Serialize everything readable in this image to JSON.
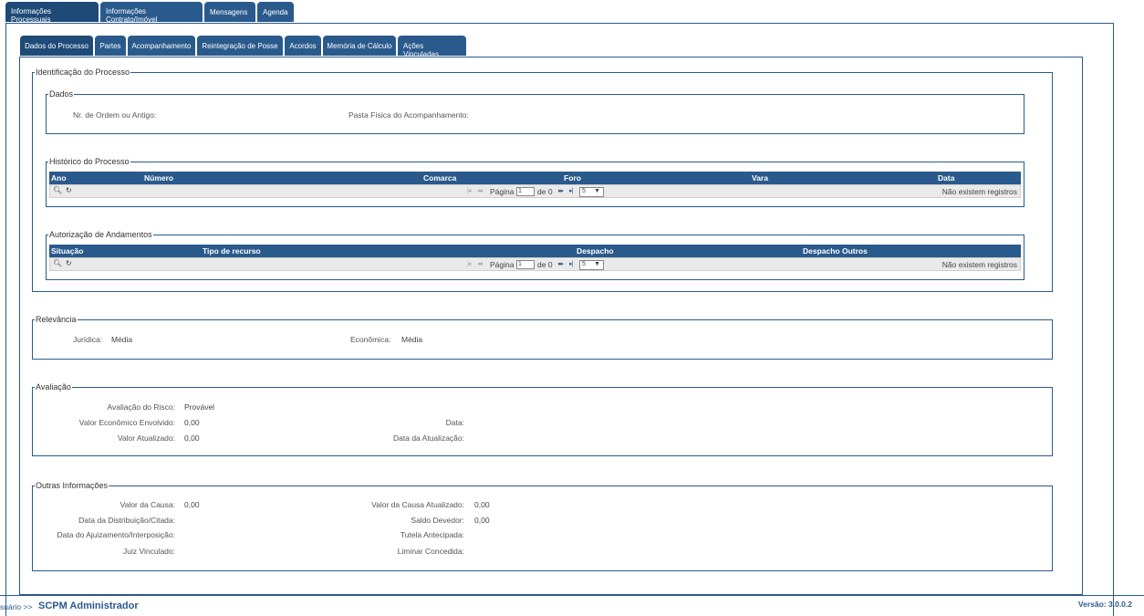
{
  "top_tabs": [
    {
      "line1": "Informações",
      "line2": "Processuais"
    },
    {
      "line1": "Informações",
      "line2": "Contrato/Imóvel"
    },
    {
      "line1": "Mensagens",
      "line2": ""
    },
    {
      "line1": "Agenda",
      "line2": ""
    }
  ],
  "sub_tabs": [
    {
      "line1": "Dados do Processo",
      "line2": ""
    },
    {
      "line1": "Partes",
      "line2": ""
    },
    {
      "line1": "Acompanhamento",
      "line2": ""
    },
    {
      "line1": "Reintegração de Posse",
      "line2": ""
    },
    {
      "line1": "Acordos",
      "line2": ""
    },
    {
      "line1": "Memória de Cálculo",
      "line2": ""
    },
    {
      "line1": "Ações",
      "line2": "Vinculadas"
    }
  ],
  "identificacao": {
    "legend": "Identificação do Processo",
    "dados": {
      "legend": "Dados",
      "nr_ordem_label": "Nr. de Ordem ou Antigo:",
      "pasta_label": "Pasta Física do Acompanhamento:"
    },
    "historico": {
      "legend": "Histórico do Processo",
      "columns": [
        "Ano",
        "Número",
        "Comarca",
        "Foro",
        "Vara",
        "Data"
      ],
      "pager": {
        "pagina_label": "Página",
        "page_value": "1",
        "de_label": "de 0",
        "page_size": "5",
        "empty_text": "Não existem registros"
      }
    },
    "autorizacao": {
      "legend": "Autorização de Andamentos",
      "columns": [
        "Situação",
        "Tipo de recurso",
        "Despacho",
        "Despacho Outros"
      ],
      "pager": {
        "pagina_label": "Página",
        "page_value": "1",
        "de_label": "de 0",
        "page_size": "5",
        "empty_text": "Não existem registros"
      }
    }
  },
  "relevancia": {
    "legend": "Relevância",
    "juridica_label": "Jurídica:",
    "juridica_value": "Média",
    "economica_label": "Econômica:",
    "economica_value": "Média"
  },
  "avaliacao": {
    "legend": "Avaliação",
    "risco_label": "Avaliação do Risco:",
    "risco_value": "Provável",
    "valor_economico_label": "Valor Econômico Envolvido:",
    "valor_economico_value": "0,00",
    "data_label": "Data:",
    "valor_atualizado_label": "Valor Atualizado:",
    "valor_atualizado_value": "0,00",
    "data_atualizacao_label": "Data da Atualização:"
  },
  "outras": {
    "legend": "Outras Informações",
    "valor_causa_label": "Valor da Causa:",
    "valor_causa_value": "0,00",
    "valor_causa_atualizado_label": "Valor da Causa Atualizado:",
    "valor_causa_atualizado_value": "0,00",
    "data_distribuicao_label": "Data da Distribuição/Citada:",
    "saldo_devedor_label": "Saldo Devedor:",
    "saldo_devedor_value": "0,00",
    "data_ajuizamento_label": "Data do Ajuizamento/Interposição:",
    "tutela_label": "Tutela Antecipada:",
    "juiz_label": "Juiz Vinculado:",
    "liminar_label": "Liminar Concedida:"
  },
  "footer": {
    "user_prefix": "suário >>",
    "user_name": "SCPM Administrador",
    "version": "Versão: 3.0.0.2"
  },
  "colors": {
    "primary": "#2a5a8c",
    "active_tab": "#1e4a78",
    "pager_bg": "#eaeaea"
  }
}
